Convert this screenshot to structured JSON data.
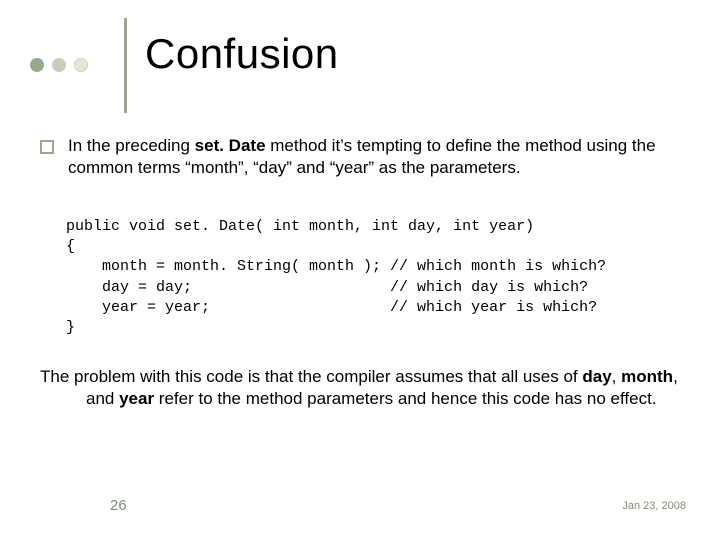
{
  "title": "Confusion",
  "bullet": {
    "pre1": "In the preceding ",
    "bold1": "set. Date",
    "post1": " method it’s tempting to define the method using the common terms “month”, “day” and “year” as the parameters."
  },
  "code": {
    "l1": "public void set. Date( int month, int day, int year)",
    "l2": "{",
    "l3": "    month = month. String( month ); // which month is which?",
    "l4": "    day = day;                      // which day is which?",
    "l5": "    year = year;                    // which year is which?",
    "l6": "}"
  },
  "trailer": {
    "t1": "The problem with this code is that the compiler assumes that all uses of ",
    "b1": "day",
    "c1": ", ",
    "b2": "month",
    "c2": ", and ",
    "b3": "year",
    "t2": " refer to the method parameters and hence this code has no effect."
  },
  "footer": {
    "page": "26",
    "date": "Jan 23, 2008"
  }
}
